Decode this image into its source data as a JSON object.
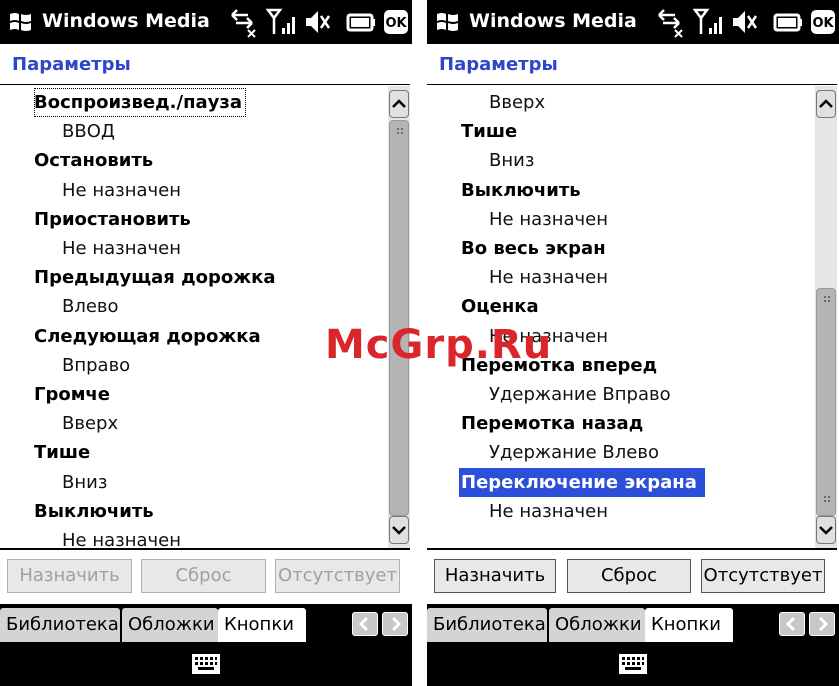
{
  "app": {
    "title": "Windows Media"
  },
  "header": {
    "title": "Параметры"
  },
  "left_list": [
    {
      "text": "Воспроизвед./пауза",
      "kind": "cmd"
    },
    {
      "text": "ВВОД",
      "kind": "val"
    },
    {
      "text": "Остановить",
      "kind": "cmd"
    },
    {
      "text": "Не назначен",
      "kind": "val"
    },
    {
      "text": "Приостановить",
      "kind": "cmd"
    },
    {
      "text": "Не назначен",
      "kind": "val"
    },
    {
      "text": "Предыдущая дорожка",
      "kind": "cmd"
    },
    {
      "text": "Влево",
      "kind": "val"
    },
    {
      "text": "Следующая дорожка",
      "kind": "cmd"
    },
    {
      "text": "Вправо",
      "kind": "val"
    },
    {
      "text": "Громче",
      "kind": "cmd"
    },
    {
      "text": "Вверх",
      "kind": "val"
    },
    {
      "text": "Тише",
      "kind": "cmd"
    },
    {
      "text": "Вниз",
      "kind": "val"
    },
    {
      "text": "Выключить",
      "kind": "cmd"
    },
    {
      "text": "Не назначен",
      "kind": "val"
    }
  ],
  "right_list": [
    {
      "text": "Вверх",
      "kind": "val"
    },
    {
      "text": "Тише",
      "kind": "cmd"
    },
    {
      "text": "Вниз",
      "kind": "val"
    },
    {
      "text": "Выключить",
      "kind": "cmd"
    },
    {
      "text": "Не назначен",
      "kind": "val"
    },
    {
      "text": "Во весь экран",
      "kind": "cmd"
    },
    {
      "text": "Не назначен",
      "kind": "val"
    },
    {
      "text": "Оценка",
      "kind": "cmd"
    },
    {
      "text": "Не назначен",
      "kind": "val"
    },
    {
      "text": "Перемотка вперед",
      "kind": "cmd"
    },
    {
      "text": "Удержание Вправо",
      "kind": "val"
    },
    {
      "text": "Перемотка назад",
      "kind": "cmd"
    },
    {
      "text": "Удержание Влево",
      "kind": "val"
    },
    {
      "text": "Переключение экрана",
      "kind": "cmd",
      "selected": true
    },
    {
      "text": "Не назначен",
      "kind": "val"
    }
  ],
  "buttons": {
    "assign": "Назначить",
    "reset": "Сброс",
    "absent": "Отсутствует"
  },
  "tabs": {
    "library": "Библиотека",
    "covers": "Обложки",
    "buttons": "Кнопки"
  },
  "icons": {
    "start": "windows-start-icon",
    "connectivity": "data-connection-icon",
    "signal": "signal-strength-icon",
    "volume": "volume-muted-icon",
    "battery": "battery-icon",
    "ok": "ok-icon",
    "keyboard": "keyboard-icon"
  },
  "colors": {
    "header_text": "#2e46c8",
    "selection": "#2b4fd8",
    "chrome": "#000000"
  },
  "watermark": "McGrp.Ru"
}
